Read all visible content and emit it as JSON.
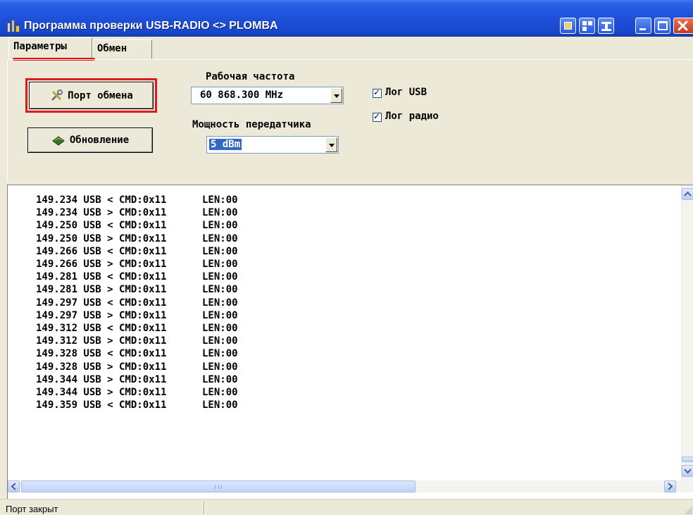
{
  "window": {
    "title": "Программа проверки USB-RADIO <> PLOMBA"
  },
  "tabs": [
    {
      "label": "Параметры",
      "active": true
    },
    {
      "label": "Обмен",
      "active": false
    }
  ],
  "controls": {
    "port_button_label": "Порт обмена",
    "update_button_label": "Обновление",
    "frequency_label": "Рабочая частота",
    "frequency_value": "60 868.300 MHz",
    "power_label": "Мощность передатчика",
    "power_value": "5 dBm",
    "log_usb_label": "Лог USB",
    "log_usb_checked": true,
    "log_radio_label": "Лог радио",
    "log_radio_checked": true
  },
  "log_lines": [
    "149.234 USB < CMD:0x11      LEN:00",
    "149.234 USB > CMD:0x11      LEN:00",
    "149.250 USB < CMD:0x11      LEN:00",
    "149.250 USB > CMD:0x11      LEN:00",
    "149.266 USB < CMD:0x11      LEN:00",
    "149.266 USB > CMD:0x11      LEN:00",
    "149.281 USB < CMD:0x11      LEN:00",
    "149.281 USB > CMD:0x11      LEN:00",
    "149.297 USB < CMD:0x11      LEN:00",
    "149.297 USB > CMD:0x11      LEN:00",
    "149.312 USB < CMD:0x11      LEN:00",
    "149.312 USB > CMD:0x11      LEN:00",
    "149.328 USB < CMD:0x11      LEN:00",
    "149.328 USB > CMD:0x11      LEN:00",
    "149.344 USB > CMD:0x11      LEN:00",
    "149.344 USB > CMD:0x11      LEN:00",
    "149.359 USB < CMD:0x11      LEN:00"
  ],
  "status": {
    "text": "Порт закрыт"
  },
  "colors": {
    "titlebar": "#1e50d8",
    "highlight": "#e01a1a",
    "selection": "#316ac5"
  }
}
